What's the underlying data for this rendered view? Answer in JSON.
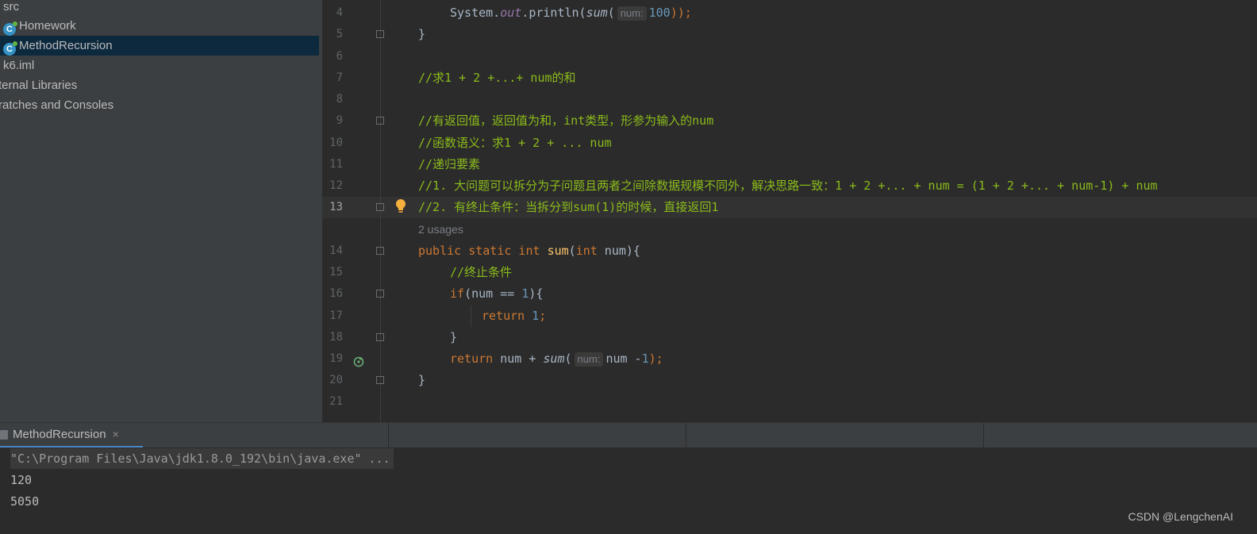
{
  "project_tree": {
    "items": [
      {
        "label": "src",
        "icon": "folder-icon"
      },
      {
        "label": "Homework",
        "icon": "java-class-icon"
      },
      {
        "label": "MethodRecursion",
        "icon": "java-class-icon"
      },
      {
        "label": "k6.iml",
        "icon": "module-file-icon"
      },
      {
        "label": "ternal Libraries",
        "icon": "library-icon"
      },
      {
        "label": "ratches and Consoles",
        "icon": "scratches-icon"
      }
    ]
  },
  "editor": {
    "line_numbers": [
      "4",
      "5",
      "6",
      "7",
      "8",
      "9",
      "10",
      "11",
      "12",
      "13",
      "14",
      "15",
      "16",
      "17",
      "18",
      "19",
      "20",
      "21"
    ],
    "current_line": "13",
    "usages_hint": "2 usages",
    "lines": {
      "l4_prefix": "System.",
      "l4_out": "out",
      "l4_mid": ".println(",
      "l4_sum": "sum",
      "l4_paren": "(",
      "l4_hint": "num:",
      "l4_num": "100",
      "l4_end": "));",
      "l5": "}",
      "l7": "//求1 + 2 +...+ num的和",
      "l9": "//有返回值，返回值为和，int类型，形参为输入的num",
      "l10": "//函数语义：求1 + 2 + ... num",
      "l11": "//递归要素",
      "l12": "//1. 大问题可以拆分为子问题且两者之间除数据规模不同外，解决思路一致：1 + 2 +... + num = (1 + 2 +... + num-1) + num",
      "l13": "//2. 有终止条件：当拆分到sum(1)的时候，直接返回1",
      "l14_kw": "public static int ",
      "l14_fn": "sum",
      "l14_paren": "(",
      "l14_kw2": "int",
      "l14_rest": " num){",
      "l15": "//终止条件",
      "l16_kw": "if",
      "l16_mid": "(num == ",
      "l16_num": "1",
      "l16_end": "){",
      "l17_kw": "return ",
      "l17_num": "1",
      "l17_end": ";",
      "l18": "}",
      "l19_kw": "return ",
      "l19_mid": "num + ",
      "l19_fn": "sum",
      "l19_paren": "(",
      "l19_hint": "num:",
      "l19_arg": "num -",
      "l19_num": "1",
      "l19_end": ");",
      "l20": "}"
    }
  },
  "run_panel": {
    "tab_label": "MethodRecursion",
    "close": "×",
    "output": [
      "\"C:\\Program Files\\Java\\jdk1.8.0_192\\bin\\java.exe\" ...",
      "120",
      "5050"
    ]
  },
  "watermark": "CSDN @LengchenAI",
  "colors": {
    "comment": "#8bbb1a",
    "keyword": "#cc7832",
    "number": "#6897bb",
    "selection": "#0d293e"
  }
}
